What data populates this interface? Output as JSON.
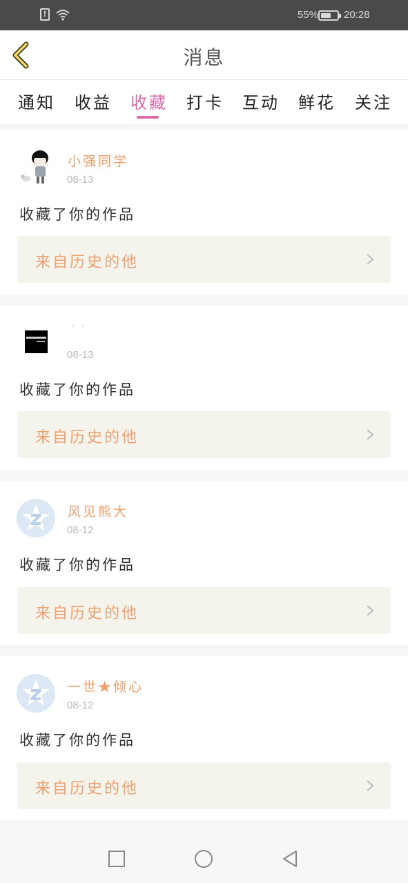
{
  "status_bar": {
    "battery": "55%",
    "time": "20:28"
  },
  "header": {
    "title": "消息"
  },
  "tabs": [
    {
      "label": "通知"
    },
    {
      "label": "收益"
    },
    {
      "label": "收藏"
    },
    {
      "label": "打卡"
    },
    {
      "label": "互动"
    },
    {
      "label": "鲜花"
    },
    {
      "label": "关注"
    }
  ],
  "active_tab": "收藏",
  "messages": [
    {
      "name": "小强同学",
      "date": "08-13",
      "action": "收藏了你的作品",
      "source": "来自历史的他",
      "avatar": "cartoon-boy"
    },
    {
      "name": "' '",
      "date": "08-13",
      "action": "收藏了你的作品",
      "source": "来自历史的他",
      "avatar": "black-square"
    },
    {
      "name": "风见熊大",
      "date": "08-12",
      "action": "收藏了你的作品",
      "source": "来自历史的他",
      "avatar": "default"
    },
    {
      "name": "一世★倾心",
      "date": "08-12",
      "action": "收藏了你的作品",
      "source": "来自历史的他",
      "avatar": "default"
    }
  ],
  "colors": {
    "accent_pink": "#e06aa7",
    "name_orange": "#f0a070",
    "source_bg": "#f5f4ec"
  }
}
